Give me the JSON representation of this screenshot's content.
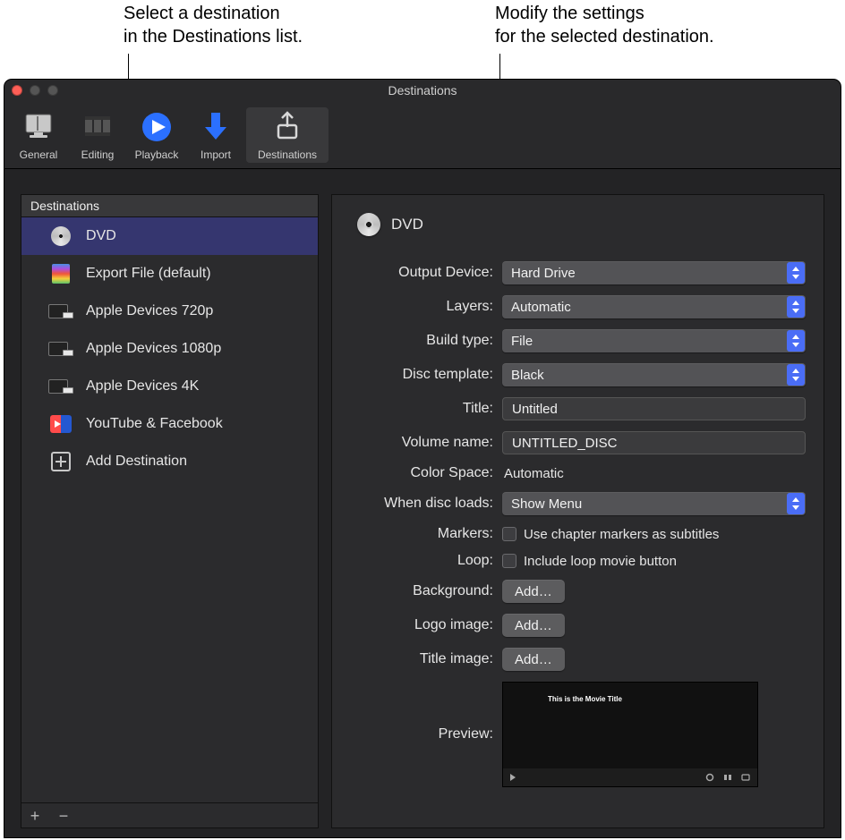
{
  "callouts": {
    "left": "Select a destination\nin the Destinations list.",
    "right": "Modify the settings\nfor the selected destination."
  },
  "window": {
    "title": "Destinations"
  },
  "toolbar": {
    "general": "General",
    "editing": "Editing",
    "playback": "Playback",
    "import": "Import",
    "destinations": "Destinations"
  },
  "sidebar": {
    "header": "Destinations",
    "items": [
      {
        "label": "DVD",
        "icon": "disc"
      },
      {
        "label": "Export File (default)",
        "icon": "file"
      },
      {
        "label": "Apple Devices 720p",
        "icon": "device"
      },
      {
        "label": "Apple Devices 1080p",
        "icon": "device"
      },
      {
        "label": "Apple Devices 4K",
        "icon": "device"
      },
      {
        "label": "YouTube & Facebook",
        "icon": "yt"
      },
      {
        "label": "Add Destination",
        "icon": "plus"
      }
    ]
  },
  "detail": {
    "name": "DVD",
    "labels": {
      "output_device": "Output Device:",
      "layers": "Layers:",
      "build_type": "Build type:",
      "disc_template": "Disc template:",
      "title": "Title:",
      "volume_name": "Volume name:",
      "color_space": "Color Space:",
      "when_disc_loads": "When disc loads:",
      "markers": "Markers:",
      "loop": "Loop:",
      "background": "Background:",
      "logo_image": "Logo image:",
      "title_image": "Title image:",
      "preview": "Preview:"
    },
    "values": {
      "output_device": "Hard Drive",
      "layers": "Automatic",
      "build_type": "File",
      "disc_template": "Black",
      "title": "Untitled",
      "volume_name": "UNTITLED_DISC",
      "color_space": "Automatic",
      "when_disc_loads": "Show Menu",
      "markers_label": "Use chapter markers as subtitles",
      "loop_label": "Include loop movie button",
      "add": "Add…",
      "preview_title": "This is the Movie Title"
    }
  }
}
